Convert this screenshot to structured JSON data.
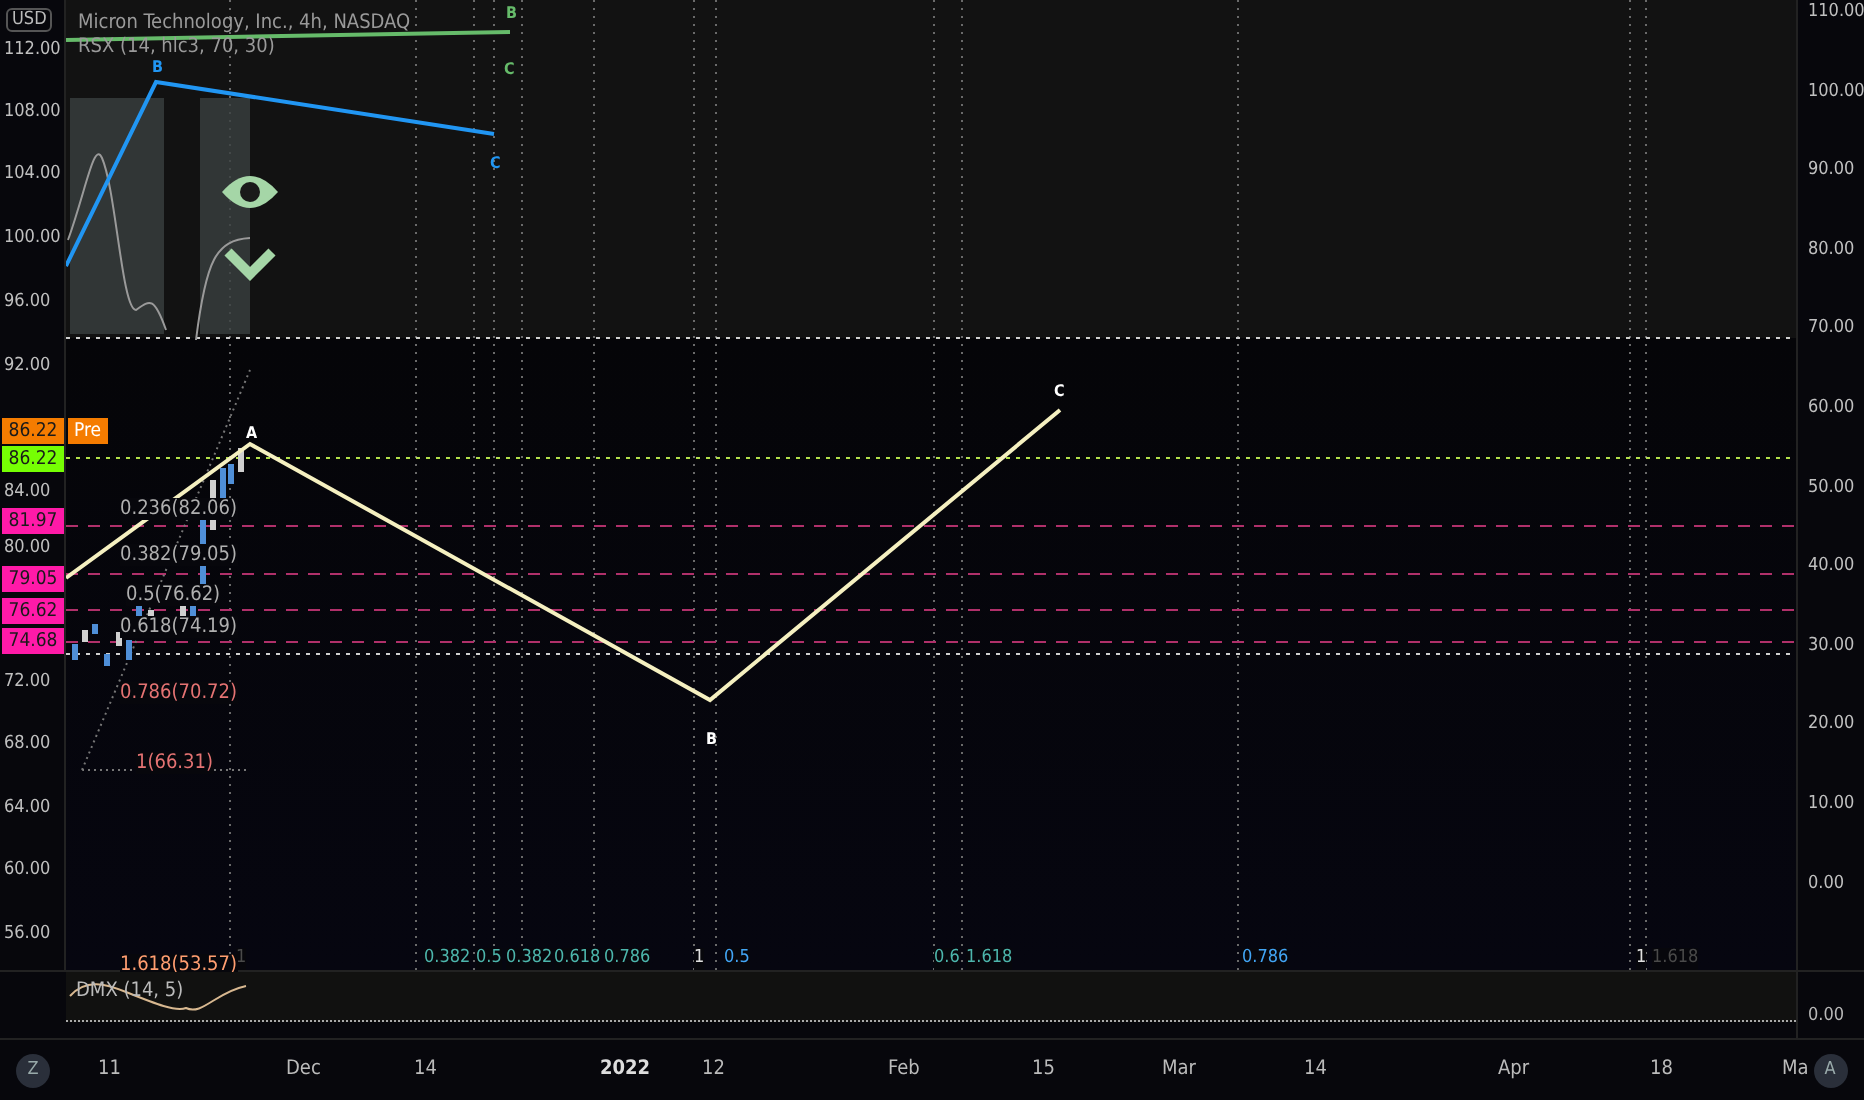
{
  "currency": "USD",
  "header": {
    "title": "Micron Technology, Inc., 4h, NASDAQ",
    "indicator": "RSX (14, hlc3, 70, 30)"
  },
  "left_axis": {
    "ticks": [
      "112.00",
      "108.00",
      "104.00",
      "100.00",
      "96.00",
      "92.00",
      "84.00",
      "80.00",
      "72.00",
      "68.00",
      "64.00",
      "60.00",
      "56.00"
    ]
  },
  "right_axis": {
    "ticks": [
      "110.00",
      "100.00",
      "90.00",
      "80.00",
      "70.00",
      "60.00",
      "50.00",
      "40.00",
      "30.00",
      "20.00",
      "10.00",
      "0.00"
    ]
  },
  "price_badges": [
    {
      "label": "86.22",
      "color": "#f57c00",
      "tag": "Pre"
    },
    {
      "label": "86.22",
      "color": "#76ff03"
    },
    {
      "label": "81.97",
      "color": "#ff1aa8"
    },
    {
      "label": "79.05",
      "color": "#ff1aa8"
    },
    {
      "label": "76.62",
      "color": "#ff1aa8"
    },
    {
      "label": "74.68",
      "color": "#ff1aa8"
    }
  ],
  "fib_levels": [
    {
      "label": "0.236(82.06)",
      "color": "#b0b0b0"
    },
    {
      "label": "0.382(79.05)",
      "color": "#b0b0b0"
    },
    {
      "label": "0.5(76.62)",
      "color": "#b0b0b0"
    },
    {
      "label": "0.618(74.19)",
      "color": "#b0b0b0"
    },
    {
      "label": "0.786(70.72)",
      "color": "#e57373"
    },
    {
      "label": "1(66.31)",
      "color": "#e57373"
    },
    {
      "label": "1.618(53.57)",
      "color": "#ff9e70"
    }
  ],
  "time_fibs": [
    {
      "label": "1",
      "color": "#4a4a4a"
    },
    {
      "label": "0.382",
      "color": "#4db6ac"
    },
    {
      "label": "0.5",
      "color": "#4db6ac"
    },
    {
      "label": "0.382",
      "color": "#4db6ac"
    },
    {
      "label": "0.618",
      "color": "#4db6ac"
    },
    {
      "label": "0.786",
      "color": "#4db6ac"
    },
    {
      "label": "1",
      "color": "#e0e0e0"
    },
    {
      "label": "0.5",
      "color": "#42a5f5"
    },
    {
      "label": "0.6",
      "color": "#4db6ac"
    },
    {
      "label": "1.618",
      "color": "#4db6ac"
    },
    {
      "label": "0.786",
      "color": "#42a5f5"
    },
    {
      "label": "1",
      "color": "#e0e0e0"
    },
    {
      "label": "1.618",
      "color": "#4a4a4a"
    }
  ],
  "wave_labels": [
    {
      "label": "B",
      "color": "#66bb6a"
    },
    {
      "label": "C",
      "color": "#66bb6a"
    },
    {
      "label": "B",
      "color": "#2196f3"
    },
    {
      "label": "C",
      "color": "#2196f3"
    },
    {
      "label": "A",
      "color": "#ffffff"
    },
    {
      "label": "B",
      "color": "#ffffff"
    },
    {
      "label": "C",
      "color": "#ffffff"
    }
  ],
  "indicator_pane": {
    "label": "DMX (14, 5)",
    "tick": "0.00"
  },
  "time_axis": [
    {
      "label": "11",
      "bold": false
    },
    {
      "label": "Dec",
      "bold": false
    },
    {
      "label": "14",
      "bold": false
    },
    {
      "label": "2022",
      "bold": true
    },
    {
      "label": "12",
      "bold": false
    },
    {
      "label": "Feb",
      "bold": false
    },
    {
      "label": "15",
      "bold": false
    },
    {
      "label": "Mar",
      "bold": false
    },
    {
      "label": "14",
      "bold": false
    },
    {
      "label": "Apr",
      "bold": false
    },
    {
      "label": "18",
      "bold": false
    },
    {
      "label": "Ma",
      "bold": false
    }
  ],
  "buttons": {
    "left": "Z",
    "right": "A"
  }
}
